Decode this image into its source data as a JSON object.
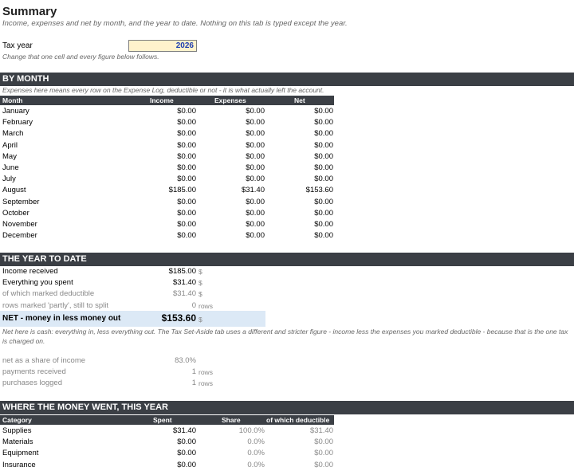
{
  "title": "Summary",
  "subtitle": "Income, expenses and net by month, and the year to date. Nothing on this tab is typed except the year.",
  "tax_year": {
    "label": "Tax year",
    "value": "2026",
    "hint": "Change that one cell and every figure below follows."
  },
  "by_month": {
    "heading": "BY MONTH",
    "note": "Expenses here means every row on the Expense Log, deductible or not - it is what actually left the account.",
    "columns": [
      "Month",
      "Income",
      "Expenses",
      "Net"
    ],
    "rows": [
      [
        "January",
        "$0.00",
        "$0.00",
        "$0.00"
      ],
      [
        "February",
        "$0.00",
        "$0.00",
        "$0.00"
      ],
      [
        "March",
        "$0.00",
        "$0.00",
        "$0.00"
      ],
      [
        "April",
        "$0.00",
        "$0.00",
        "$0.00"
      ],
      [
        "May",
        "$0.00",
        "$0.00",
        "$0.00"
      ],
      [
        "June",
        "$0.00",
        "$0.00",
        "$0.00"
      ],
      [
        "July",
        "$0.00",
        "$0.00",
        "$0.00"
      ],
      [
        "August",
        "$185.00",
        "$31.40",
        "$153.60"
      ],
      [
        "September",
        "$0.00",
        "$0.00",
        "$0.00"
      ],
      [
        "October",
        "$0.00",
        "$0.00",
        "$0.00"
      ],
      [
        "November",
        "$0.00",
        "$0.00",
        "$0.00"
      ],
      [
        "December",
        "$0.00",
        "$0.00",
        "$0.00"
      ]
    ]
  },
  "ytd": {
    "heading": "THE YEAR TO DATE",
    "rows": [
      {
        "label": "Income received",
        "value": "$185.00",
        "unit": "$"
      },
      {
        "label": "Everything you spent",
        "value": "$31.40",
        "unit": "$"
      },
      {
        "label": "of which marked deductible",
        "value": "$31.40",
        "unit": "$"
      },
      {
        "label": "rows marked 'partly', still to split",
        "value": "0",
        "unit": "rows"
      }
    ],
    "net_label": "NET - money in less money out",
    "net_value": "$153.60",
    "net_unit": "$",
    "net_note": "Net here is cash: everything in, less everything out. The Tax Set-Aside tab uses a different and stricter figure - income less the expenses you marked deductible - because that is the one tax is charged on.",
    "extra": [
      {
        "label": "net as a share of income",
        "value": "83.0%",
        "unit": ""
      },
      {
        "label": "payments received",
        "value": "1",
        "unit": "rows"
      },
      {
        "label": "purchases logged",
        "value": "1",
        "unit": "rows"
      }
    ]
  },
  "where": {
    "heading": "WHERE THE MONEY WENT, THIS YEAR",
    "columns": [
      "Category",
      "Spent",
      "Share",
      "of which deductible"
    ],
    "rows": [
      [
        "Supplies",
        "$31.40",
        "100.0%",
        "$31.40"
      ],
      [
        "Materials",
        "$0.00",
        "0.0%",
        "$0.00"
      ],
      [
        "Equipment",
        "$0.00",
        "0.0%",
        "$0.00"
      ],
      [
        "Insurance",
        "$0.00",
        "0.0%",
        "$0.00"
      ]
    ]
  }
}
